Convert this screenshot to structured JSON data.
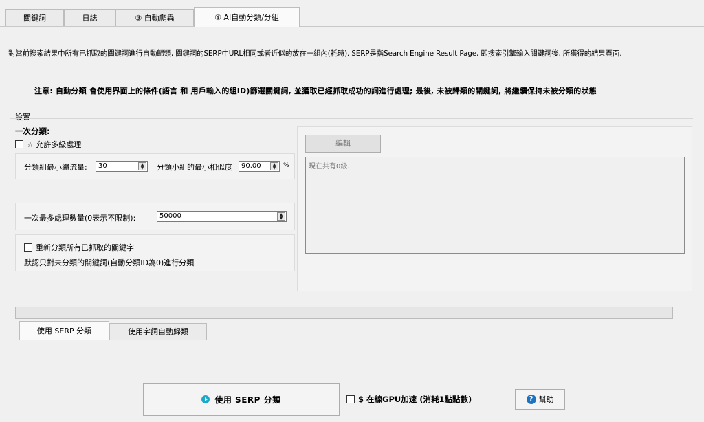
{
  "tabs": [
    {
      "label": "關鍵詞"
    },
    {
      "label": "日誌"
    },
    {
      "label": "③ 自動爬蟲"
    },
    {
      "label": "④ AI自動分類/分組"
    }
  ],
  "description": "對當前搜索結果中所有已抓取的關鍵詞進行自動歸類, 關鍵詞的SERP中URL相同或者近似的放在一組內(耗時).  SERP是指Search Engine Result Page, 即搜索引擎輸入關鍵詞後, 所獲得的結果頁面.",
  "notice": "注意: 自動分類 會使用界面上的條件(語言 和 用戶輸入的組ID)篩選關鍵詞, 並獲取已經抓取成功的詞進行處理; 最後, 未被歸類的關鍵詞, 將繼續保持未被分類的狀態",
  "settings": {
    "title": "設置",
    "first_classification": "一次分類:",
    "allow_multilevel": "☆ 允許多級處理",
    "min_total_traffic_label": "分類組最小總流量:",
    "min_total_traffic_value": "30",
    "min_similarity_label": "分類小組的最小相似度",
    "min_similarity_value": "90.00",
    "min_similarity_unit": "%",
    "max_process_label": "一次最多處理數量(0表示不限制):",
    "max_process_value": "50000",
    "reclassify_label": "重新分類所有已抓取的關鍵字",
    "reclassify_note": "默認只對未分類的關鍵詞(自動分類ID為0)進行分類"
  },
  "editor": {
    "edit_label": "編輯",
    "content": "現在共有0級."
  },
  "progress": {
    "value": 0
  },
  "subtabs": [
    {
      "label": "使用 SERP 分類"
    },
    {
      "label": "使用字詞自動歸類"
    }
  ],
  "actions": {
    "run_label": "使用 SERP 分類",
    "gpu_label": "$ 在線GPU加速 (消耗1點點數)",
    "help_label": "幫助"
  },
  "colors": {
    "accent_icon": "#1ba9c9",
    "help_icon": "#1e73be"
  }
}
